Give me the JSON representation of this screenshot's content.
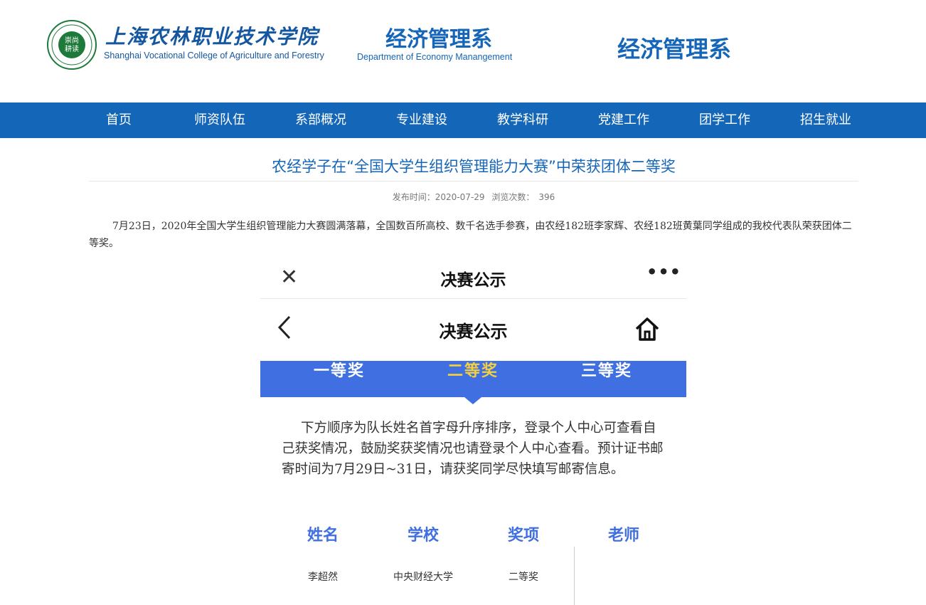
{
  "header": {
    "college_cn": "上海农林职业技术学院",
    "college_en": "Shanghai Vocational College of Agriculture and Forestry",
    "dept_cn": "经济管理系",
    "dept_en": "Department of Economy Manangement",
    "dept_cn_right": "经济管理系"
  },
  "nav": {
    "items": [
      "首页",
      "师资队伍",
      "系部概况",
      "专业建设",
      "教学科研",
      "党建工作",
      "团学工作",
      "招生就业"
    ]
  },
  "article": {
    "title": "农经学子在“全国大学生组织管理能力大赛”中荣获团体二等奖",
    "publish_label": "发布时间：2020-07-29",
    "views_label": "浏览次数：",
    "views_count": "396",
    "body": "7月23日，2020年全国大学生组织管理能力大赛圆满落幕，全国数百所高校、数千名选手参赛，由农经182班李家辉、农经182班黄葉同学组成的我校代表队荣获团体二等奖。"
  },
  "screenshot": {
    "wx_title": "决赛公示",
    "wx_more": "•••",
    "page_title": "决赛公示",
    "tabs": [
      "一等奖",
      "二等奖",
      "三等奖"
    ],
    "active_tab": 1,
    "notice": "下方顺序为队长姓名首字母升序排序，登录个人中心可查看自己获奖情况，鼓励奖获奖情况也请登录个人中心查看。预计证书邮寄时间为7月29日~31日，请获奖同学尽快填写邮寄信息。",
    "table": {
      "headers": [
        "姓名",
        "学校",
        "奖项",
        "老师"
      ],
      "rows": [
        [
          "李超然",
          "中央财经大学",
          "二等奖",
          ""
        ]
      ]
    }
  },
  "colors": {
    "brand_blue": "#1466b8",
    "tab_blue": "#3f6fe0",
    "active_tab_yellow": "#f4d03f"
  }
}
